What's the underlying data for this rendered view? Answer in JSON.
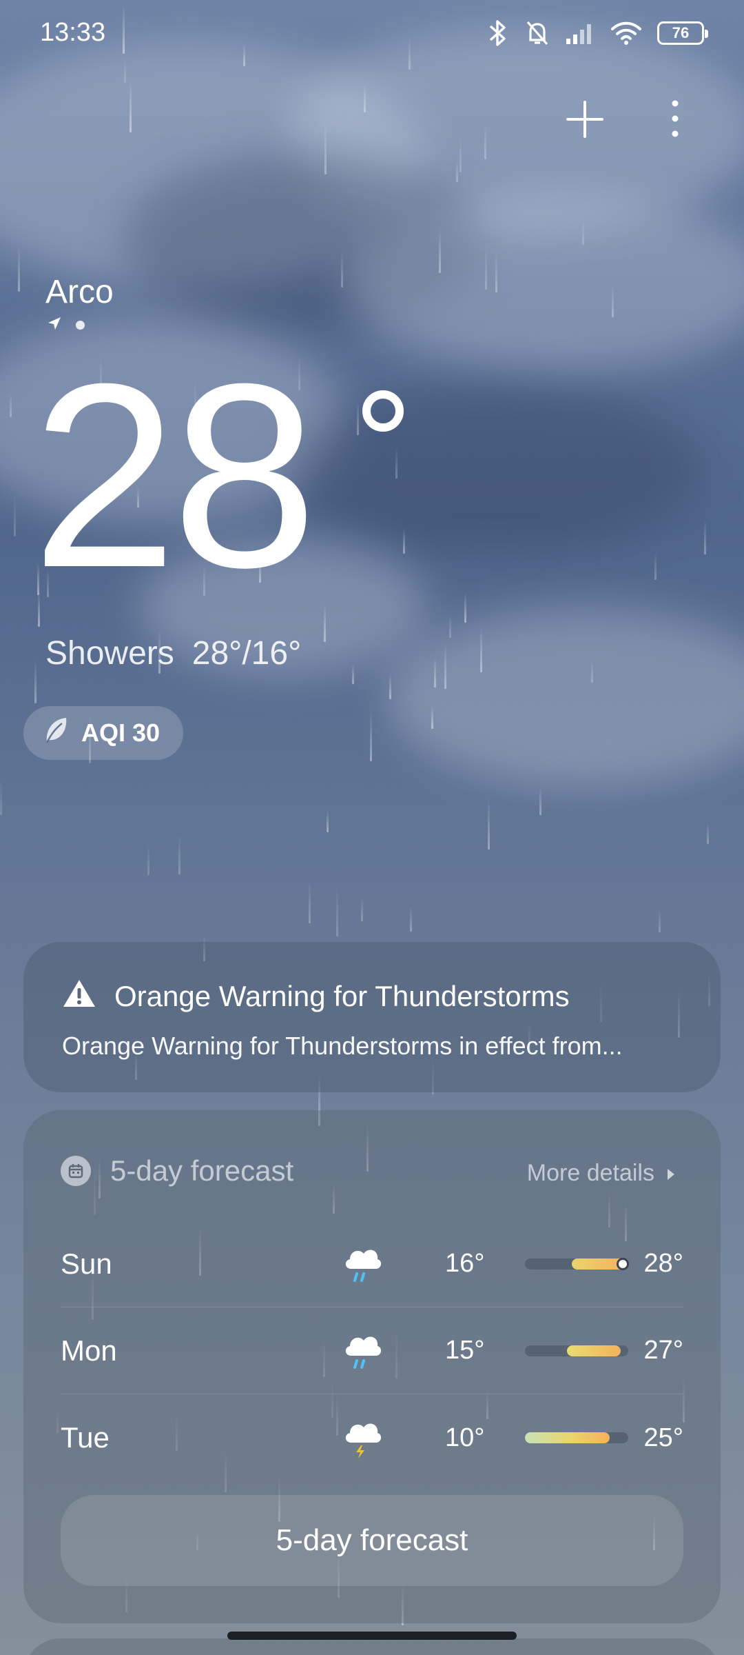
{
  "status_bar": {
    "time": "13:33",
    "battery": "76",
    "icons": [
      "bluetooth-icon",
      "bell-off-icon",
      "signal-icon",
      "wifi-icon",
      "battery-icon"
    ]
  },
  "header": {
    "actions": [
      "add-icon",
      "more-vert-icon"
    ]
  },
  "current": {
    "location": "Arco",
    "temperature": "28",
    "condition": "Showers",
    "high_low": "28°/16°",
    "aqi_label": "AQI 30"
  },
  "warning": {
    "title": "Orange Warning for Thunderstorms",
    "text": "Orange Warning for Thunderstorms in effect from..."
  },
  "forecast": {
    "title": "5-day forecast",
    "more_label": "More details",
    "button_label": "5-day forecast",
    "days": [
      {
        "day": "Sun",
        "icon": "rain-cloud-icon",
        "low": "16°",
        "high": "28°",
        "low_value": 16,
        "high_value": 28,
        "current": 28
      },
      {
        "day": "Mon",
        "icon": "rain-cloud-icon",
        "low": "15°",
        "high": "27°",
        "low_value": 15,
        "high_value": 27
      },
      {
        "day": "Tue",
        "icon": "thunderstorm-icon",
        "low": "10°",
        "high": "25°",
        "low_value": 10,
        "high_value": 25
      }
    ],
    "range_min": 10,
    "range_max": 28
  },
  "colors": {
    "bar_warm": "#f4b25c",
    "bar_yellow": "#ecd36e",
    "bar_green": "#c8e3b8",
    "rain_icon": "#4fc3f7",
    "lightning_icon": "#f2c230"
  }
}
